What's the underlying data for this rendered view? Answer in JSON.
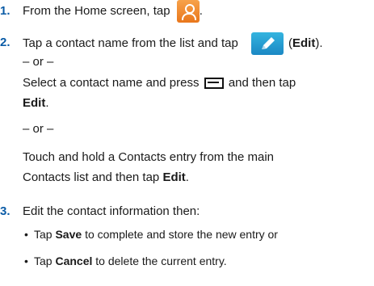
{
  "steps": [
    {
      "number": "1.",
      "text_before": "From the Home screen, tap",
      "text_after": ".",
      "icon": "contacts-icon"
    },
    {
      "number": "2.",
      "line1_before": "Tap a contact name from the list and tap",
      "line1_paren_open": "(",
      "line1_bold": "Edit",
      "line1_paren_close": ").",
      "icon": "edit-pencil-icon",
      "or1": "– or –",
      "line2_before": "Select a contact name and press",
      "line2_after": "and then tap",
      "menu_icon": "menu-icon",
      "line3_bold": "Edit",
      "line3_after": ".",
      "or2": "– or –",
      "line4": "Touch and hold a Contacts entry from the main",
      "line5_before": "Contacts list and then tap",
      "line5_bold": "Edit",
      "line5_after": "."
    },
    {
      "number": "3.",
      "text": "Edit the contact information then:",
      "bullets": [
        {
          "symbol": "•",
          "before": "Tap",
          "bold": "Save",
          "after": "to complete and store the new entry or"
        },
        {
          "symbol": "•",
          "before": "Tap",
          "bold": "Cancel",
          "after": "to delete the current entry."
        }
      ]
    }
  ],
  "colors": {
    "step_number": "#0a5ba6",
    "contacts_icon": "#f08a2f",
    "edit_icon": "#1b88c4"
  }
}
